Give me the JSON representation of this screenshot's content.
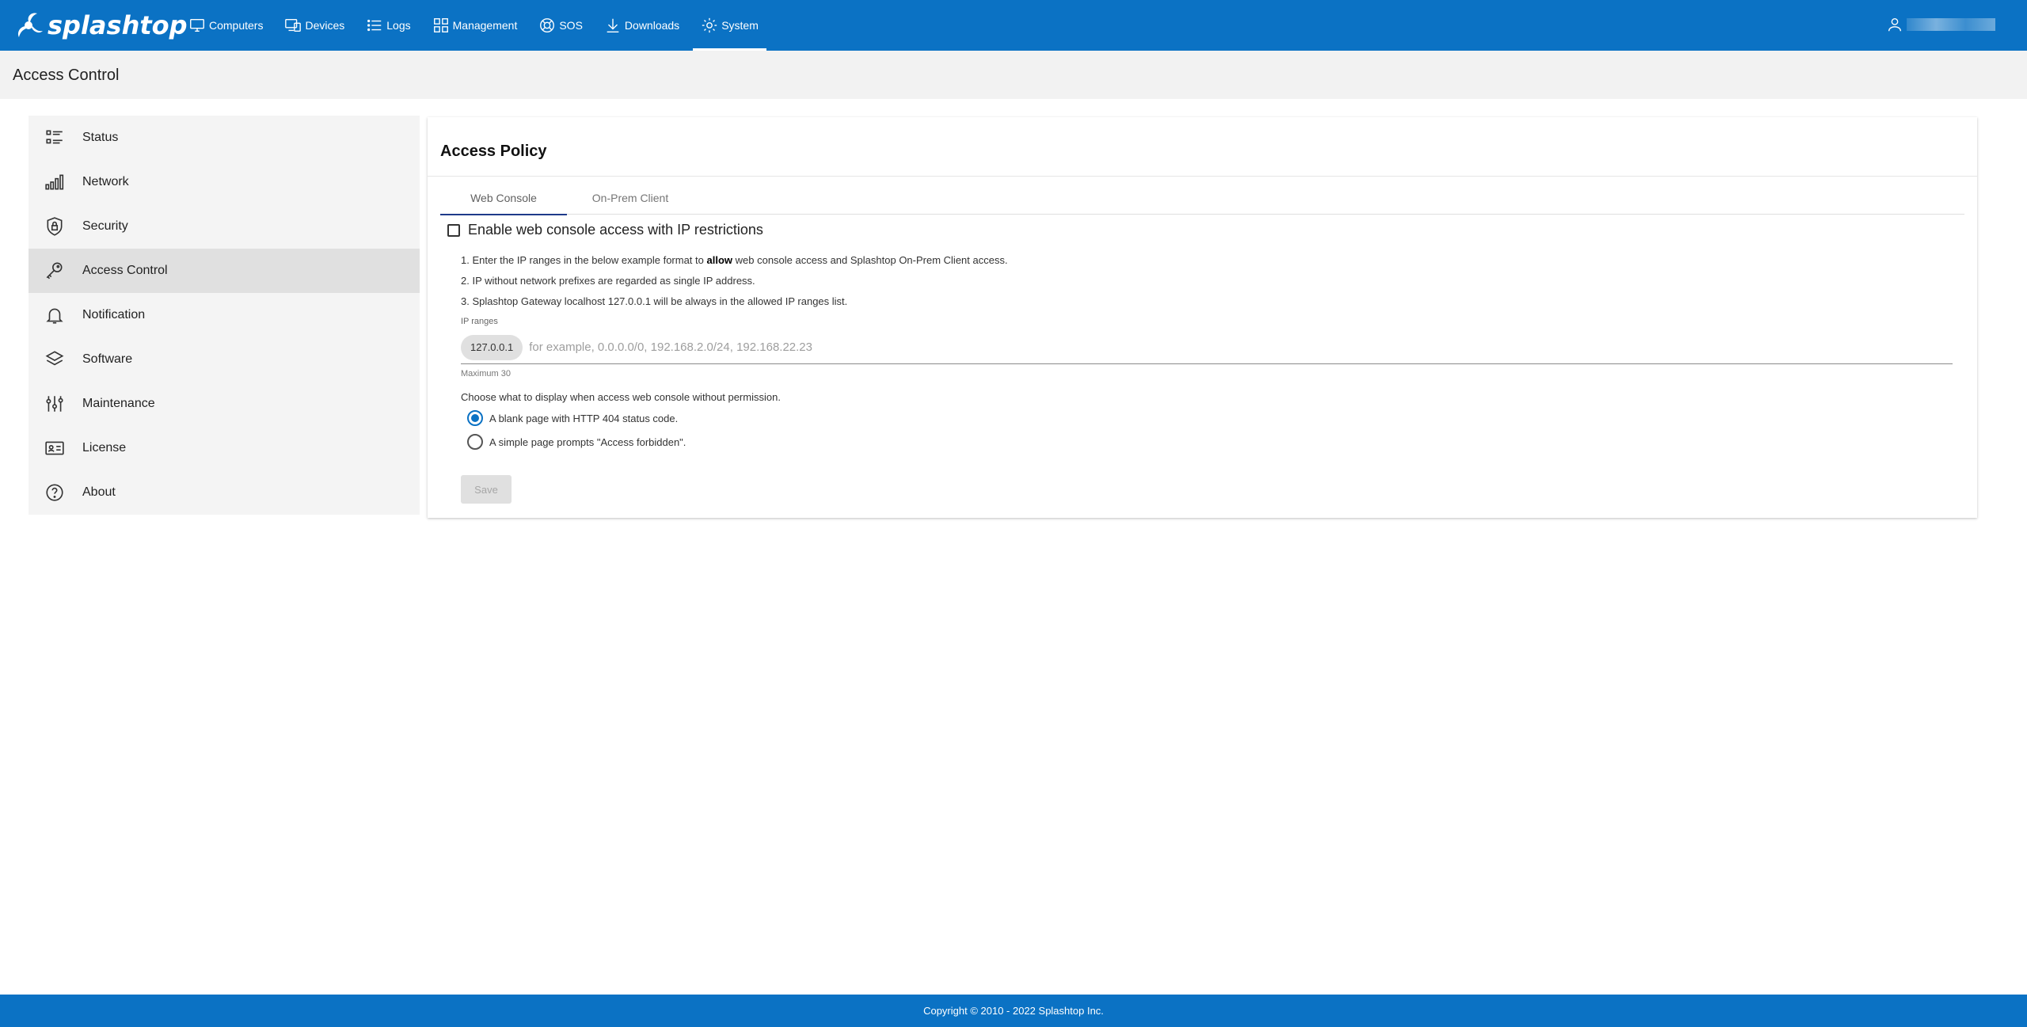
{
  "brand": {
    "name": "splashtop"
  },
  "nav": {
    "items": [
      {
        "label": "Computers",
        "icon": "monitor-icon"
      },
      {
        "label": "Devices",
        "icon": "devices-icon"
      },
      {
        "label": "Logs",
        "icon": "list-icon"
      },
      {
        "label": "Management",
        "icon": "grid-icon"
      },
      {
        "label": "SOS",
        "icon": "lifebuoy-icon"
      },
      {
        "label": "Downloads",
        "icon": "download-icon"
      },
      {
        "label": "System",
        "icon": "gear-icon",
        "active": true
      }
    ]
  },
  "page": {
    "title": "Access Control"
  },
  "sidebar": {
    "items": [
      {
        "label": "Status",
        "icon": "status-list-icon"
      },
      {
        "label": "Network",
        "icon": "signal-bars-icon"
      },
      {
        "label": "Security",
        "icon": "shield-icon"
      },
      {
        "label": "Access Control",
        "icon": "key-icon",
        "active": true
      },
      {
        "label": "Notification",
        "icon": "bell-icon"
      },
      {
        "label": "Software",
        "icon": "layers-icon"
      },
      {
        "label": "Maintenance",
        "icon": "sliders-icon"
      },
      {
        "label": "License",
        "icon": "id-card-icon"
      },
      {
        "label": "About",
        "icon": "help-circle-icon"
      }
    ]
  },
  "policy": {
    "title": "Access Policy",
    "tabs": [
      {
        "label": "Web Console",
        "active": true
      },
      {
        "label": "On-Prem Client"
      }
    ],
    "enable_label": "Enable web console access with IP restrictions",
    "enabled": false,
    "instructions": {
      "line1_pre": "1. Enter the IP ranges in the below example format to ",
      "line1_bold": "allow",
      "line1_post": " web console access and Splashtop On-Prem Client access.",
      "line2": "2. IP without network prefixes are regarded as single IP address.",
      "line3": "3. Splashtop Gateway localhost 127.0.0.1 will be always in the allowed IP ranges list."
    },
    "ip_label": "IP ranges",
    "ip_chip": "127.0.0.1",
    "ip_placeholder": "for example, 0.0.0.0/0, 192.168.2.0/24, 192.168.22.23",
    "max_hint": "Maximum 30",
    "choose_label": "Choose what to display when access web console without permission.",
    "options": [
      {
        "label": "A blank page with HTTP 404 status code.",
        "checked": true
      },
      {
        "label": "A simple page prompts \"Access forbidden\".",
        "checked": false
      }
    ],
    "save_label": "Save"
  },
  "footer": {
    "copyright": "Copyright © 2010 - 2022 Splashtop Inc."
  },
  "colors": {
    "brand_blue": "#0b72c4",
    "tab_indicator": "#1e3a8a"
  }
}
